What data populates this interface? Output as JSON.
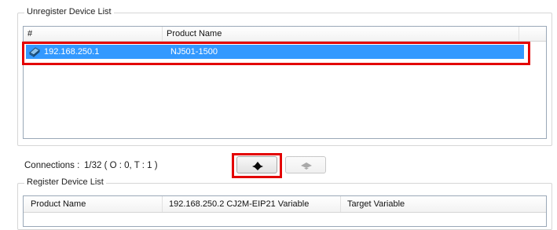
{
  "unregister_group": {
    "title": "Unregister Device List",
    "columns": [
      "#",
      "Product Name"
    ],
    "rows": [
      {
        "address": "192.168.250.1",
        "product": "NJ501-1500",
        "icon": "device-icon",
        "selected": true
      }
    ]
  },
  "connections": {
    "label": "Connections :",
    "value": "1/32 ( O : 0, T : 1 )"
  },
  "buttons": {
    "register_icon": "arrow-down-icon",
    "unregister_icon": "arrow-up-icon"
  },
  "register_group": {
    "title": "Register Device List",
    "columns": [
      "Product Name",
      "192.168.250.2 CJ2M-EIP21 Variable",
      "Target Variable"
    ]
  },
  "colors": {
    "selection": "#3399ff",
    "highlight": "#e30000"
  }
}
